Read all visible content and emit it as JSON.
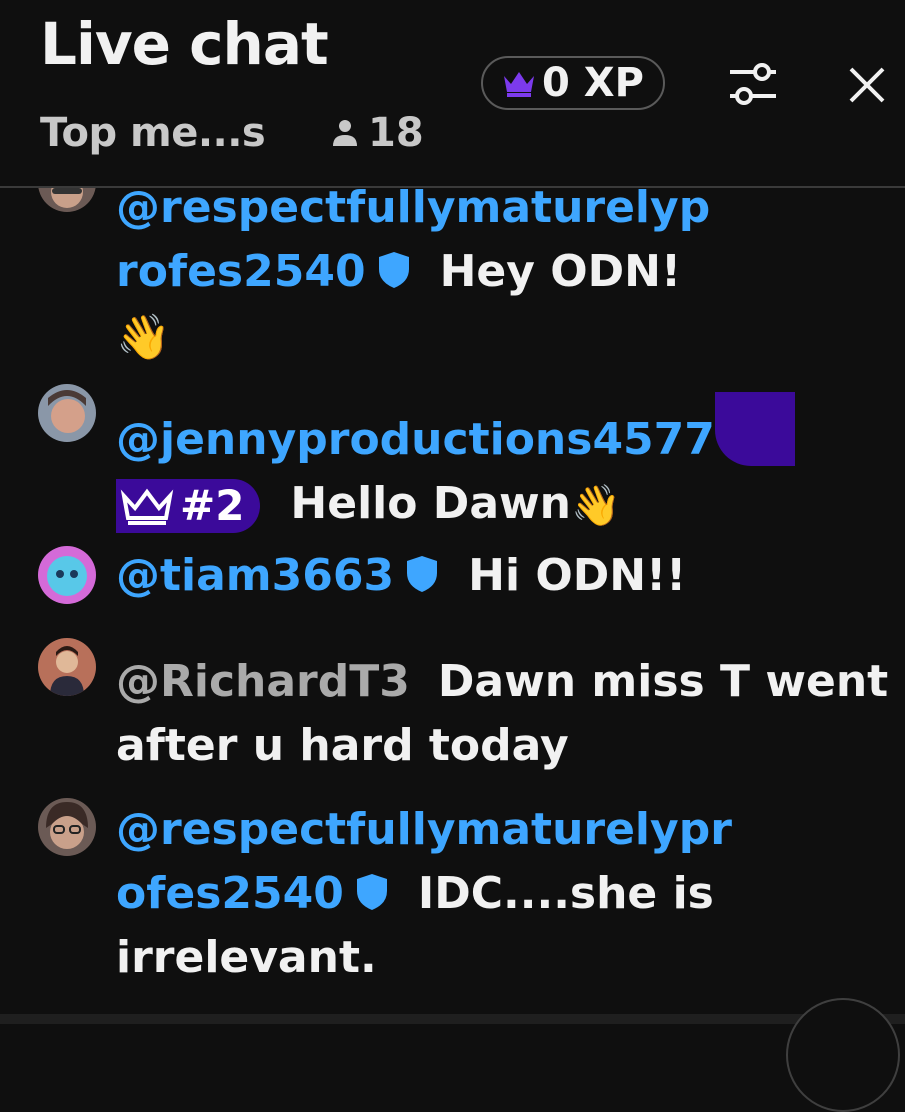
{
  "header": {
    "title": "Live chat",
    "xp_label": "0 XP",
    "sort_label": "Top me...s",
    "viewer_count": "18",
    "icons": {
      "crown": "crown-icon",
      "filter": "sliders-icon",
      "close": "close-icon",
      "viewers": "person-icon"
    },
    "colors": {
      "crown": "#7c3aed"
    }
  },
  "messages": [
    {
      "author_line1": "@respectfullymaturelyp",
      "author_line2": "rofes2540",
      "text": "Hey ODN!",
      "emoji": "👋",
      "verified": true
    },
    {
      "author": "@jennyproductions4577",
      "rank": "#2",
      "text": "Hello Dawn",
      "emoji": "👋"
    },
    {
      "author": "@tiam3663",
      "text": "Hi ODN!!",
      "verified": true
    },
    {
      "author": "@RichardT3",
      "text": "Dawn miss T went",
      "text2": "after u hard today"
    },
    {
      "author_line1": "@respectfullymaturelypr",
      "author_line2": "ofes2540",
      "text": "IDC....she is",
      "text2": "irrelevant.",
      "verified": true
    }
  ],
  "colors": {
    "author": "#3ea6ff",
    "background": "#0f0f0f",
    "member_badge": "#3b0a9a"
  }
}
